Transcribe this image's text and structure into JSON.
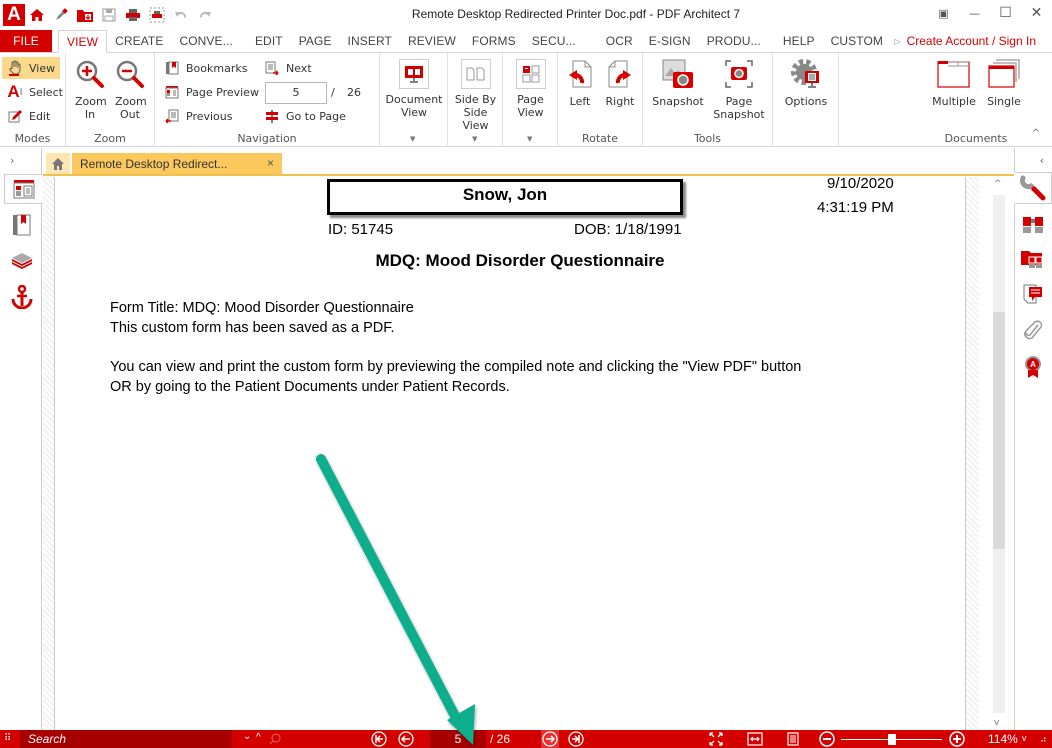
{
  "window": {
    "title": "Remote Desktop Redirected Printer Doc.pdf   -   PDF Architect 7",
    "quick_access": [
      "app-logo",
      "home-icon",
      "pen-icon",
      "open-folder-icon",
      "save-icon",
      "print-icon",
      "print-preview-icon",
      "undo-icon",
      "redo-icon"
    ],
    "controls": {
      "restore": "▣",
      "minimize": "—",
      "maximize": "☐",
      "close": "✕"
    }
  },
  "ribbon_tabs": [
    {
      "label": "FILE"
    },
    {
      "label": "VIEW"
    },
    {
      "label": "CREATE"
    },
    {
      "label": "CONVE..."
    },
    {
      "label": "EDIT"
    },
    {
      "label": "PAGE"
    },
    {
      "label": "INSERT"
    },
    {
      "label": "REVIEW"
    },
    {
      "label": "FORMS"
    },
    {
      "label": "SECU..."
    },
    {
      "label": "OCR"
    },
    {
      "label": "E-SIGN"
    },
    {
      "label": "PRODU..."
    },
    {
      "label": "HELP"
    },
    {
      "label": "CUSTOM"
    }
  ],
  "account_link": "Create Account / Sign In",
  "ribbon": {
    "modes": {
      "label": "Modes",
      "view": "View",
      "select": "Select",
      "edit": "Edit"
    },
    "zoom": {
      "label": "Zoom",
      "zoom_in": "Zoom In",
      "zoom_out": "Zoom Out"
    },
    "navigation": {
      "label": "Navigation",
      "bookmarks": "Bookmarks",
      "page_preview": "Page Preview",
      "previous": "Previous",
      "next": "Next",
      "current_page": "5",
      "separator": "/",
      "total_pages": "26",
      "go_to_page": "Go to Page"
    },
    "views": {
      "document_view": "Document View",
      "side_by_side": "Side By Side View",
      "page_view": "Page View"
    },
    "rotate": {
      "label": "Rotate",
      "left": "Left",
      "right": "Right"
    },
    "tools": {
      "label": "Tools",
      "snapshot": "Snapshot",
      "page_snapshot": "Page Snapshot"
    },
    "options": "Options",
    "documents": {
      "label": "Documents",
      "multiple": "Multiple",
      "single": "Single"
    }
  },
  "doc_tab": {
    "label": "Remote Desktop Redirect...",
    "close": "×"
  },
  "document": {
    "patient_name": "Snow, Jon",
    "date": "9/10/2020",
    "time": "4:31:19 PM",
    "id": "ID: 51745",
    "dob": "DOB: 1/18/1991",
    "heading": "MDQ: Mood Disorder Questionnaire",
    "lines": [
      "Form Title: MDQ: Mood Disorder Questionnaire",
      "This custom form has been saved as a PDF.",
      "You can view and print the custom form by previewing the compiled note and clicking the \"View PDF\" button",
      "OR by going to the Patient Documents under Patient Records."
    ]
  },
  "statusbar": {
    "search_placeholder": "Search",
    "current_page": "5",
    "total_pages": "/ 26",
    "zoom_level": "114%",
    "zoom_slider_fraction": 0.5
  },
  "annotation": {
    "color": "#0aae8c",
    "target": "current-page-field"
  }
}
